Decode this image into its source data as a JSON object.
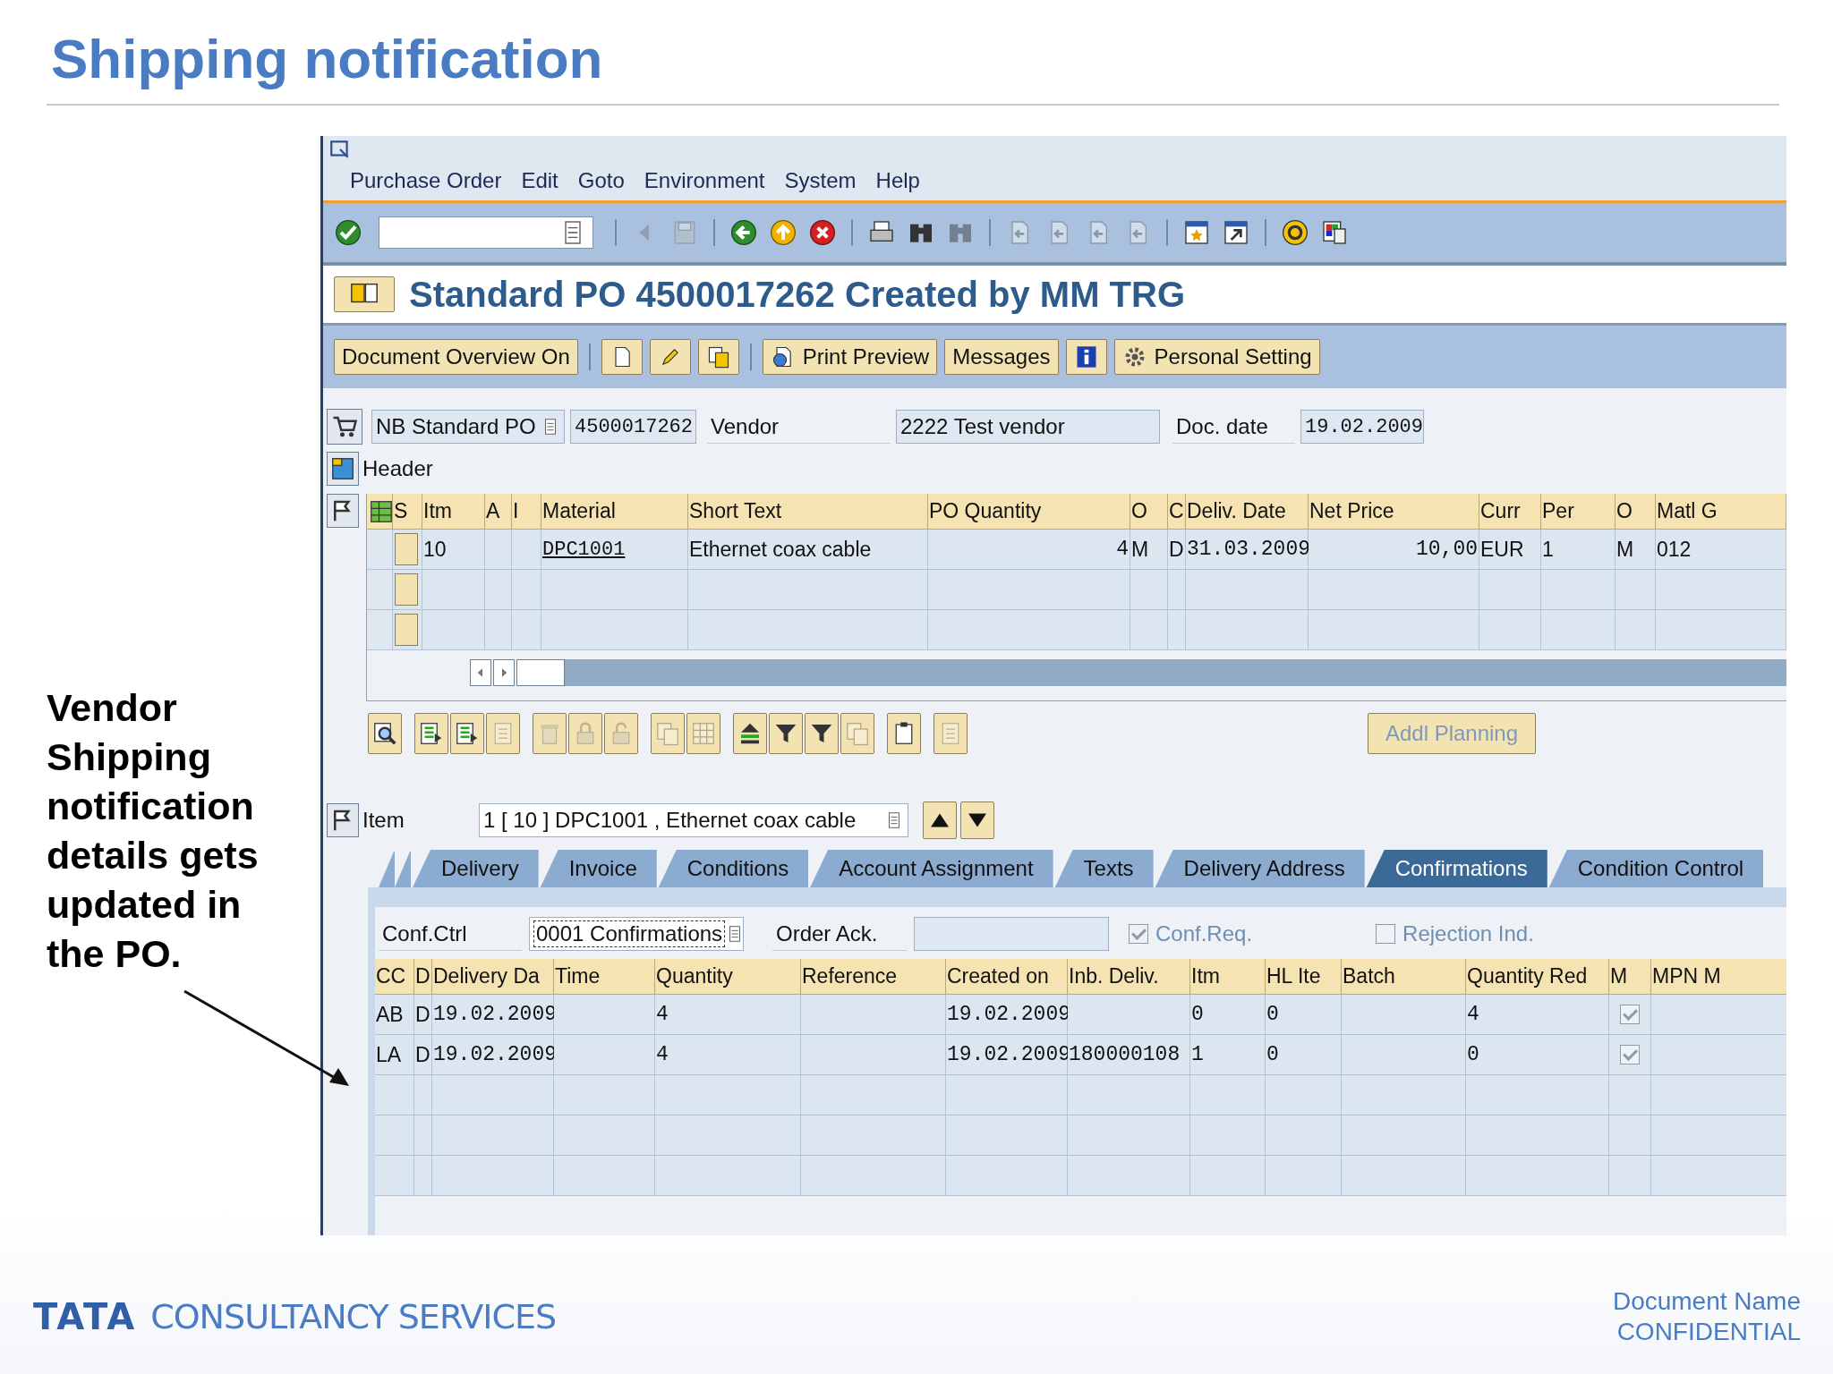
{
  "slide": {
    "title": "Shipping notification",
    "note": "Vendor Shipping notification details gets updated in the PO.",
    "footer": {
      "logo_mark": "TATA",
      "logo_text": "CONSULTANCY SERVICES",
      "doc_name": "Document Name",
      "classification": "CONFIDENTIAL"
    }
  },
  "sap": {
    "menu": [
      "Purchase Order",
      "Edit",
      "Goto",
      "Environment",
      "System",
      "Help"
    ],
    "system_toolbar": [
      [
        {
          "kind": "enter",
          "disabled": false
        }
      ],
      [
        {
          "kind": "prior",
          "disabled": true
        },
        {
          "kind": "save",
          "disabled": true
        }
      ],
      [
        {
          "kind": "back",
          "disabled": false
        },
        {
          "kind": "exit",
          "disabled": false
        },
        {
          "kind": "cancel",
          "disabled": false
        }
      ],
      [
        {
          "kind": "print",
          "disabled": false
        },
        {
          "kind": "find",
          "disabled": false
        },
        {
          "kind": "find",
          "disabled": true
        }
      ],
      [
        {
          "kind": "pagearrow",
          "disabled": true
        },
        {
          "kind": "pagearrow",
          "disabled": true
        },
        {
          "kind": "pagearrow",
          "disabled": true
        },
        {
          "kind": "pagearrow",
          "disabled": true
        }
      ],
      [
        {
          "kind": "session",
          "disabled": false
        },
        {
          "kind": "shortcut",
          "disabled": false
        }
      ],
      [
        {
          "kind": "help",
          "disabled": false
        },
        {
          "kind": "layout",
          "disabled": false
        }
      ]
    ],
    "screen_title": "Standard PO 4500017262 Created by MM TRG",
    "app_toolbar": [
      [
        {
          "kind": "plain",
          "label": "Document Overview On"
        }
      ],
      [
        {
          "kind": "document"
        },
        {
          "kind": "pencil"
        },
        {
          "kind": "pages"
        }
      ],
      [
        {
          "kind": "preview",
          "label": "Print Preview"
        },
        {
          "kind": "plain",
          "label": "Messages"
        },
        {
          "kind": "info"
        },
        {
          "kind": "gear",
          "label": "Personal Setting"
        }
      ]
    ],
    "header_fields": {
      "doc_type": "NB Standard PO",
      "po_number": "4500017262",
      "vendor_label": "Vendor",
      "vendor": "2222 Test vendor",
      "doc_date_label": "Doc. date",
      "doc_date": "19.02.2009"
    },
    "header_section": "Header",
    "items_table": {
      "columns": [
        {
          "kind": "selector"
        },
        {
          "label": "S",
          "kind": "marker"
        },
        {
          "label": "Itm",
          "kind": "text"
        },
        {
          "label": "A",
          "kind": "text"
        },
        {
          "label": "I",
          "kind": "text"
        },
        {
          "label": "Material",
          "kind": "link"
        },
        {
          "label": "Short Text",
          "kind": "text"
        },
        {
          "label": "PO Quantity",
          "kind": "number"
        },
        {
          "label": "O",
          "kind": "text"
        },
        {
          "label": "C",
          "kind": "text"
        },
        {
          "label": "Deliv. Date",
          "kind": "mono"
        },
        {
          "label": "Net Price",
          "kind": "number"
        },
        {
          "label": "Curr",
          "kind": "text"
        },
        {
          "label": "Per",
          "kind": "text"
        },
        {
          "label": "O",
          "kind": "text"
        },
        {
          "label": "Matl G",
          "kind": "text"
        }
      ],
      "rows": [
        [
          null,
          null,
          "10",
          null,
          null,
          "DPC1001",
          "Ethernet coax cable",
          "4",
          "M",
          "D",
          "31.03.2009",
          "10,00",
          "EUR",
          "1",
          "M",
          "012"
        ]
      ]
    },
    "items_toolbar": [
      [
        {
          "kind": "detail",
          "disabled": false
        }
      ],
      [
        {
          "kind": "tablearrow",
          "disabled": false
        },
        {
          "kind": "tablearrow",
          "disabled": false
        },
        {
          "kind": "list",
          "disabled": true
        }
      ],
      [
        {
          "kind": "trash",
          "disabled": true
        },
        {
          "kind": "lock",
          "disabled": true
        },
        {
          "kind": "unlock",
          "disabled": true
        }
      ],
      [
        {
          "kind": "copy",
          "disabled": true
        },
        {
          "kind": "grid",
          "disabled": true
        }
      ],
      [
        {
          "kind": "sort",
          "disabled": false
        },
        {
          "kind": "filter",
          "disabled": false
        },
        {
          "kind": "filter",
          "disabled": false
        },
        {
          "kind": "copy",
          "disabled": true
        }
      ],
      [
        {
          "kind": "clipboard",
          "disabled": false
        }
      ],
      [
        {
          "kind": "list",
          "disabled": true
        }
      ]
    ],
    "addl_planning": {
      "label": "Addl Planning",
      "disabled": true
    },
    "item_selector": {
      "label": "Item",
      "value": "1 [ 10 ] DPC1001 , Ethernet coax cable"
    },
    "tabs": [
      {
        "label": "Delivery",
        "selected": false
      },
      {
        "label": "Invoice",
        "selected": false
      },
      {
        "label": "Conditions",
        "selected": false
      },
      {
        "label": "Account Assignment",
        "selected": false
      },
      {
        "label": "Texts",
        "selected": false
      },
      {
        "label": "Delivery Address",
        "selected": false
      },
      {
        "label": "Confirmations",
        "selected": true
      },
      {
        "label": "Condition Control",
        "selected": false
      }
    ],
    "confirmations": {
      "conf_ctrl_label": "Conf.Ctrl",
      "conf_ctrl": "0001 Confirmations",
      "order_ack_label": "Order Ack.",
      "checkboxes": [
        {
          "label": "Conf.Req.",
          "checked": true,
          "disabled": true
        },
        {
          "label": "Rejection Ind.",
          "checked": false,
          "disabled": true
        }
      ],
      "columns": [
        {
          "label": "CC",
          "kind": "text"
        },
        {
          "label": "D",
          "kind": "text"
        },
        {
          "label": "Delivery Da",
          "kind": "mono"
        },
        {
          "label": "Time",
          "kind": "mono"
        },
        {
          "label": "Quantity",
          "kind": "mono"
        },
        {
          "label": "Reference",
          "kind": "text"
        },
        {
          "label": "Created on",
          "kind": "mono"
        },
        {
          "label": "Inb. Deliv.",
          "kind": "mono"
        },
        {
          "label": "Itm",
          "kind": "mono"
        },
        {
          "label": "HL Ite",
          "kind": "mono"
        },
        {
          "label": "Batch",
          "kind": "text"
        },
        {
          "label": "Quantity Red",
          "kind": "mono"
        },
        {
          "label": "M",
          "kind": "checkbox"
        },
        {
          "label": "MPN M",
          "kind": "text"
        }
      ],
      "rows": [
        [
          "AB",
          "D",
          "19.02.2009",
          null,
          "4",
          null,
          "19.02.2009",
          null,
          "0",
          "0",
          null,
          "4",
          true,
          null
        ],
        [
          "LA",
          "D",
          "19.02.2009",
          null,
          "4",
          null,
          "19.02.2009",
          "180000108",
          "1",
          "0",
          null,
          "0",
          true,
          null
        ]
      ]
    }
  }
}
